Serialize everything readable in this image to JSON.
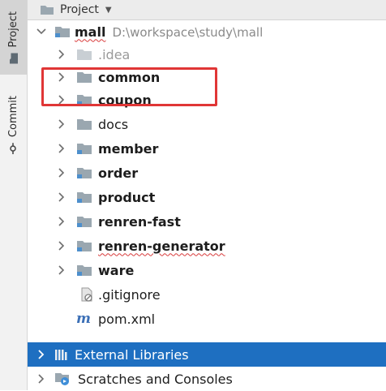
{
  "sidebar": {
    "project_tab": "Project",
    "commit_tab": "Commit"
  },
  "header": {
    "title": "Project"
  },
  "tree": {
    "root": {
      "name": "mall",
      "path": "D:\\workspace\\study\\mall"
    },
    "items": [
      {
        "name": ".idea"
      },
      {
        "name": "common"
      },
      {
        "name": "coupon"
      },
      {
        "name": "docs"
      },
      {
        "name": "member"
      },
      {
        "name": "order"
      },
      {
        "name": "product"
      },
      {
        "name": "renren-fast"
      },
      {
        "name": "renren-generator"
      },
      {
        "name": "ware"
      },
      {
        "name": ".gitignore"
      },
      {
        "name": "pom.xml"
      }
    ],
    "external": "External Libraries",
    "scratches": "Scratches and Consoles"
  },
  "colors": {
    "selection": "#1e6fc1",
    "highlight_box": "#e03636",
    "folder": "#9aa7b0"
  }
}
